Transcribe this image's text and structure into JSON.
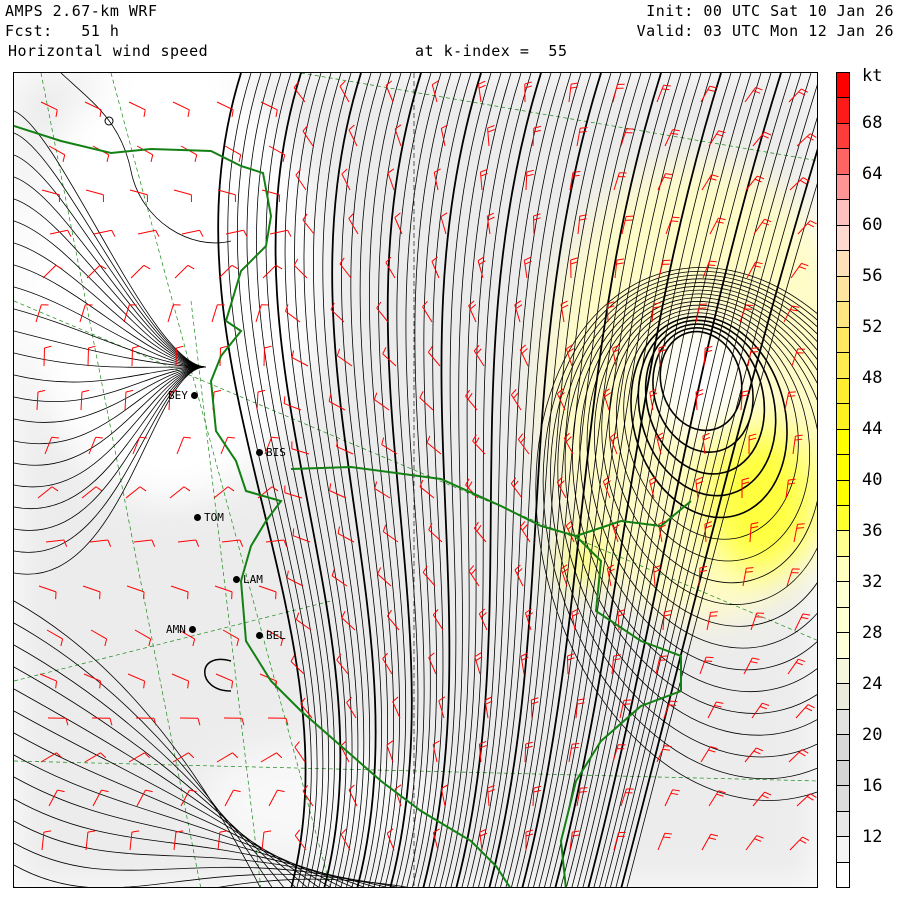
{
  "header": {
    "model": "AMPS 2.67-km WRF",
    "forecast": "Fcst:   51 h",
    "field": "Horizontal wind speed",
    "level": "at k-index =  55",
    "init": "Init: 00 UTC Sat 10 Jan 26",
    "valid": "Valid: 03 UTC Mon 12 Jan 26"
  },
  "colorbar": {
    "units": "kt",
    "labels": [
      "68",
      "64",
      "60",
      "56",
      "52",
      "48",
      "44",
      "40",
      "36",
      "32",
      "28",
      "24",
      "20",
      "16",
      "12"
    ],
    "colors": [
      "#ff0000",
      "#ff1a1a",
      "#ff3c3c",
      "#ff6464",
      "#ff9494",
      "#ffc0c0",
      "#ffd8d0",
      "#ffe0b8",
      "#ffe4a0",
      "#ffe680",
      "#ffe862",
      "#ffec50",
      "#ffee30",
      "#fff020",
      "#ffff00",
      "#ffff00",
      "#ffff00",
      "#ffff30",
      "#ffff90",
      "#ffffc0",
      "#ffffd4",
      "#ffffd4",
      "#fefed8",
      "#f6f6dc",
      "#ebebdb",
      "#e2e2e0",
      "#d8d8d8",
      "#d4d4d4",
      "#dcdcdc",
      "#e8e8e8",
      "#f4f4f4",
      "#ffffff"
    ]
  },
  "stations": [
    {
      "code": "BEY"
    },
    {
      "code": "BIS"
    },
    {
      "code": "TOM"
    },
    {
      "code": "LAM"
    },
    {
      "code": "AMN"
    },
    {
      "code": "BEL"
    }
  ]
}
